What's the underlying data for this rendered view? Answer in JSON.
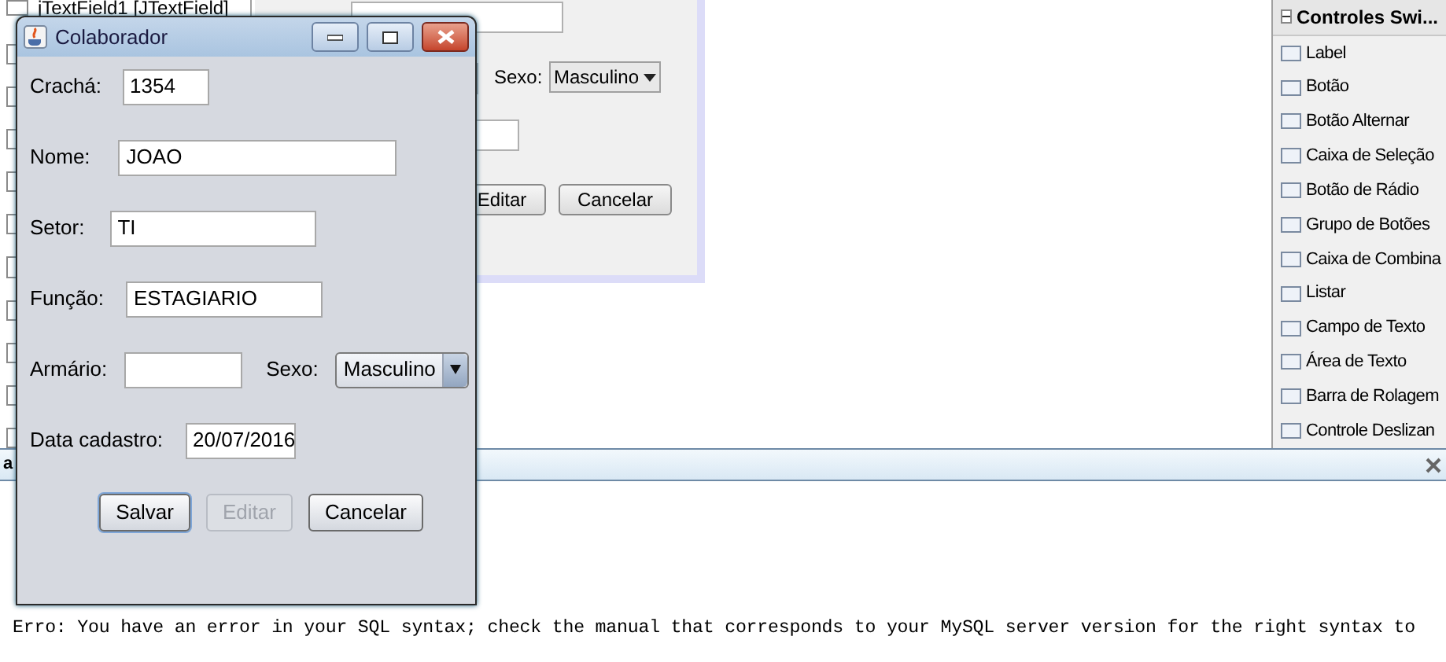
{
  "tree": {
    "items": [
      "jTextField1 [JTextField]"
    ]
  },
  "designer": {
    "sexo_label": "Sexo:",
    "sexo_combo": "Masculino",
    "buttons": [
      "Editar",
      "Cancelar"
    ]
  },
  "palette": {
    "header": "Controles Swi...",
    "expanded": true,
    "items": [
      "Label",
      "Botão",
      "Botão Alternar",
      "Caixa de Seleção",
      "Botão de Rádio",
      "Grupo de Botões",
      "Caixa de Combina",
      "Listar",
      "Campo de Texto",
      "Área de Texto",
      "Barra de Rolagem",
      "Controle Deslizan"
    ]
  },
  "output": {
    "tab_label": "a",
    "message": "Erro: You have an error in your SQL syntax; check the manual that corresponds to your MySQL server version for the right syntax to"
  },
  "dialog": {
    "title": "Colaborador",
    "fields": [
      {
        "kind": "text",
        "label": "Crachá:",
        "value": "1354"
      },
      {
        "kind": "text",
        "label": "Nome:",
        "value": "JOAO"
      },
      {
        "kind": "text",
        "label": "Setor:",
        "value": "TI"
      },
      {
        "kind": "text",
        "label": "Função:",
        "value": "ESTAGIARIO"
      },
      {
        "kind": "text_combo",
        "label": "Armário:",
        "combo_label": "Sexo:",
        "combo_value": "Masculino"
      },
      {
        "kind": "text",
        "label": "Data cadastro:",
        "value": "20/07/2016"
      }
    ],
    "buttons": [
      {
        "label": "Salvar",
        "disabled": false,
        "focused": true
      },
      {
        "label": "Editar",
        "disabled": true,
        "focused": false
      },
      {
        "label": "Cancelar",
        "disabled": false,
        "focused": false
      }
    ]
  }
}
